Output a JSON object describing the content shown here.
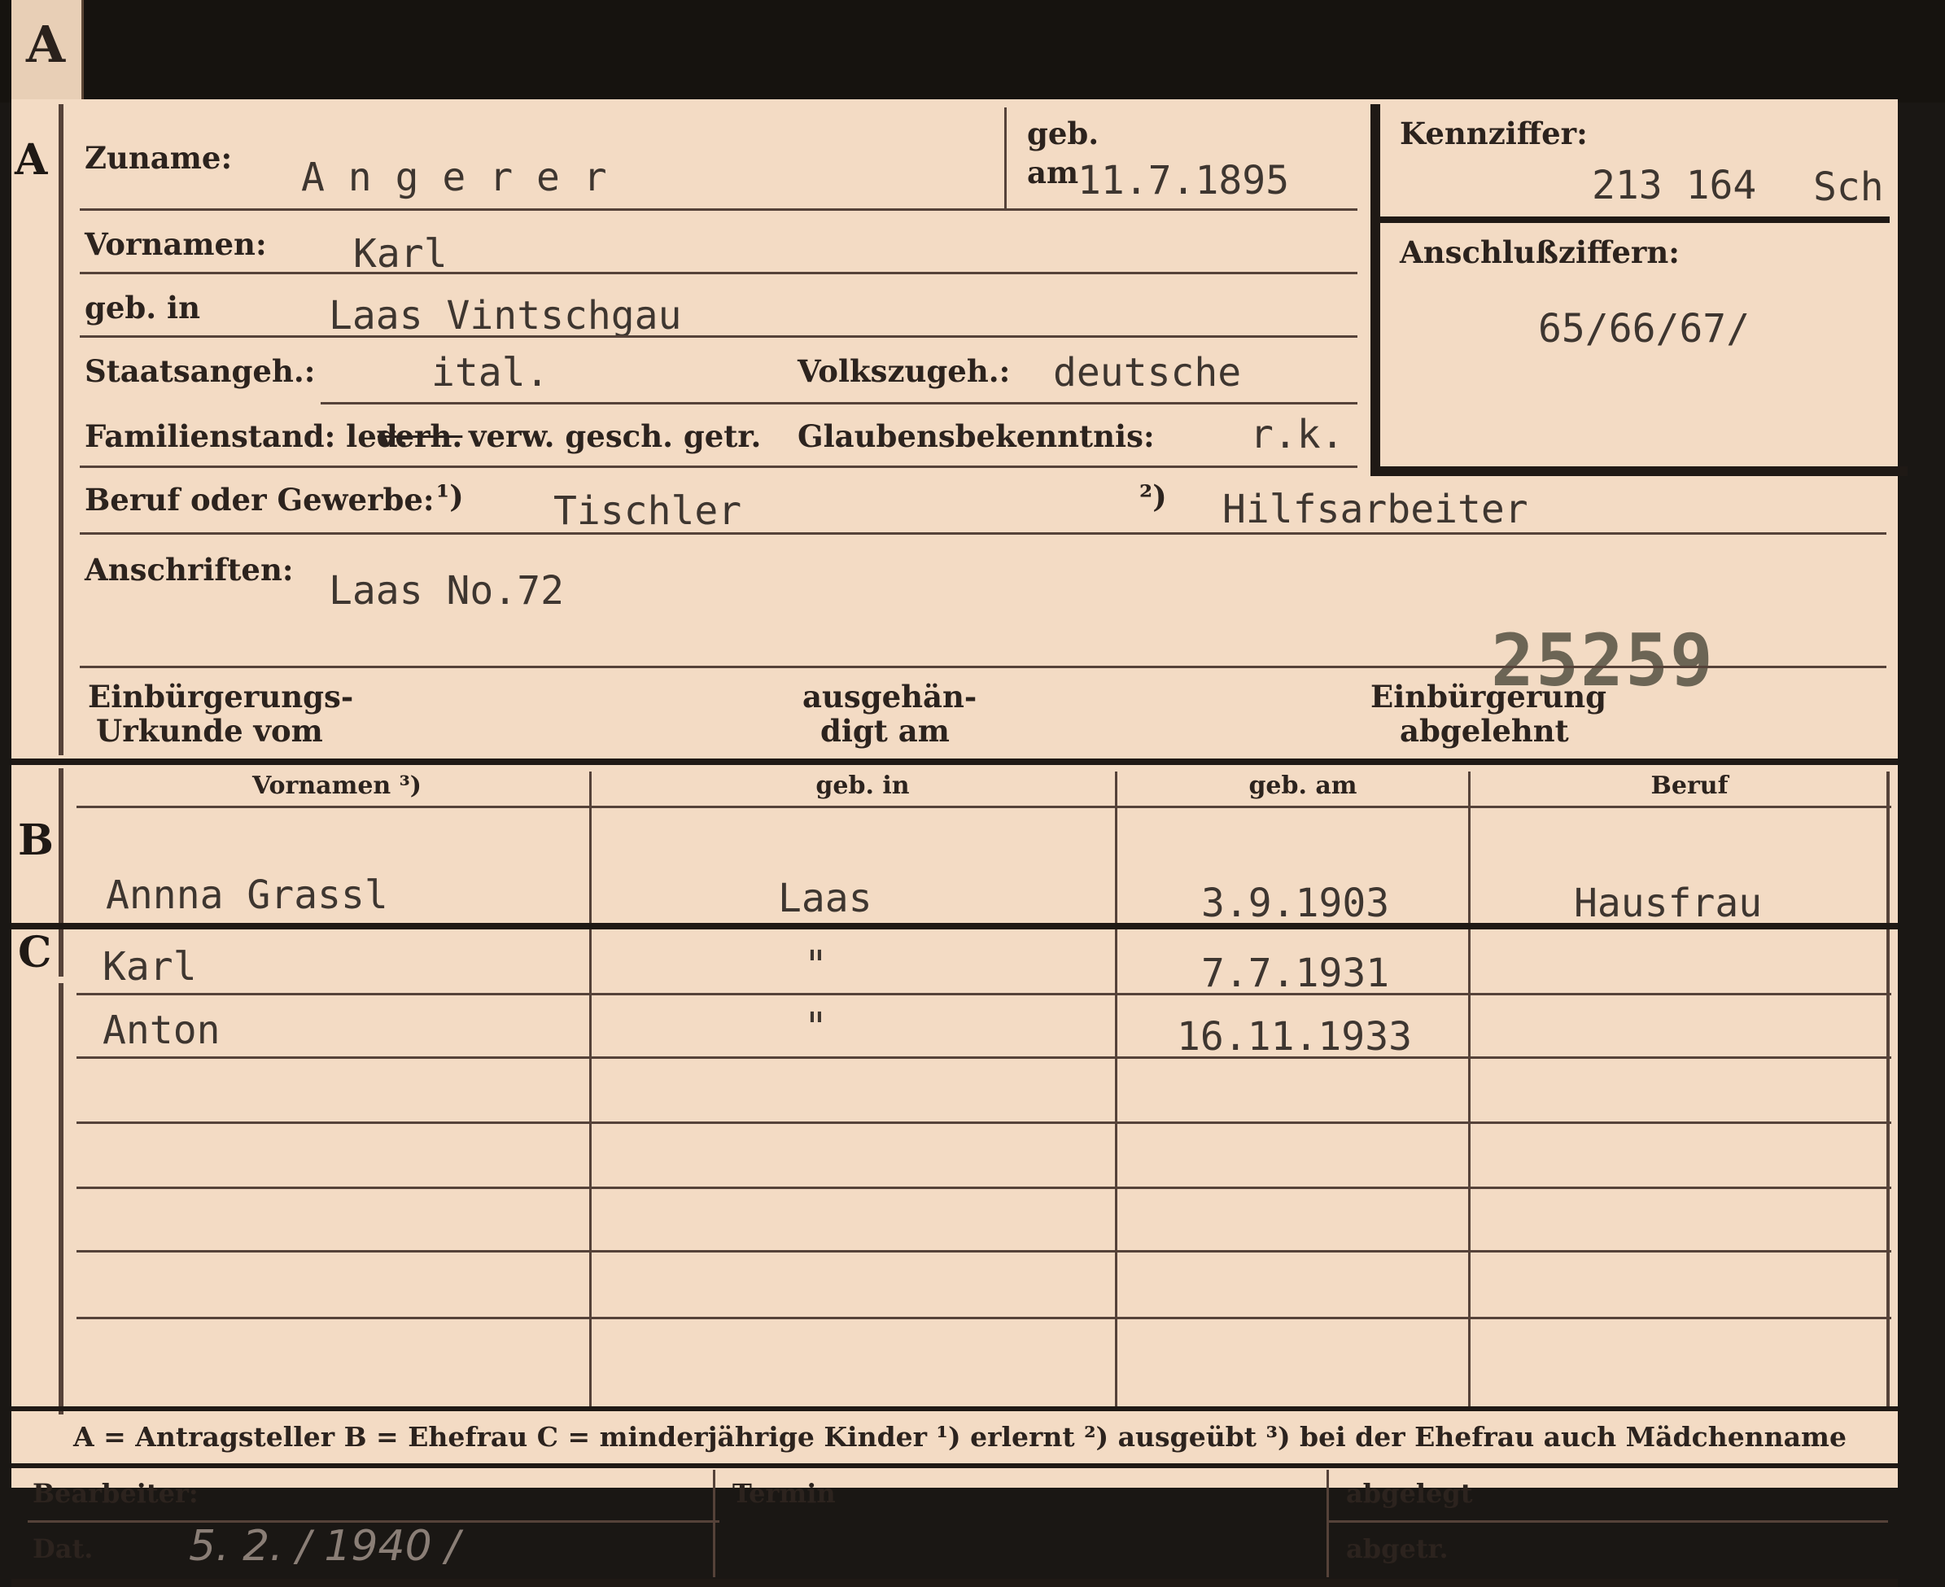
{
  "tab_letter": "A",
  "sections": {
    "a": "A",
    "b": "B",
    "c": "C"
  },
  "labels": {
    "zuname": "Zuname:",
    "geb": "geb.",
    "am": "am",
    "vornamen": "Vornamen:",
    "geb_in": "geb. in",
    "staatsangeh": "Staatsangeh.:",
    "volkszugeh": "Volkszugeh.:",
    "familienstand_prefix": "Familienstand: led.",
    "familienstand_struck": "verh.",
    "familienstand_rest": "verw. gesch. getr.",
    "glaubensbekenntnis": "Glaubensbekenntnis:",
    "beruf": "Beruf oder Gewerbe:",
    "note1": "¹)",
    "note2": "²)",
    "anschriften": "Anschriften:",
    "einb_urkunde_1": "Einbürgerungs-",
    "einb_urkunde_2": "Urkunde vom",
    "ausgehaendigt_1": "ausgehän-",
    "ausgehaendigt_2": "digt am",
    "einb_abgelehnt_1": "Einbürgerung",
    "einb_abgelehnt_2": "abgelehnt",
    "kennziffer": "Kennziffer:",
    "anschlussziffern": "Anschlußziffern:"
  },
  "applicant": {
    "surname": "A n g e r e r",
    "birth_date": "11.7.1895",
    "first_names": "Karl",
    "birth_place": "Laas Vintschgau",
    "citizenship": "ital.",
    "ethnicity": "deutsche",
    "religion": "r.k.",
    "occupation_learned": "Tischler",
    "occupation_practiced": "Hilfsarbeiter",
    "address": "Laas No.72",
    "kennziffer": "213 164",
    "kennziffer_suffix": "Sch",
    "anschlussziffern": "65/66/67/"
  },
  "stamp_number": "25259",
  "table": {
    "headers": [
      "Vornamen ³)",
      "geb. in",
      "geb. am",
      "Beruf"
    ],
    "wife": {
      "name": "Annna Grassl",
      "place": "Laas",
      "date": "3.9.1903",
      "job": "Hausfrau"
    },
    "children": [
      {
        "name": "Karl",
        "place": "\"",
        "date": "7.7.1931",
        "job": ""
      },
      {
        "name": "Anton",
        "place": "\"",
        "date": "16.11.1933",
        "job": ""
      }
    ]
  },
  "legend": "A = Antragsteller   B = Ehefrau   C = minderjährige Kinder   ¹) erlernt   ²) ausgeübt   ³) bei der Ehefrau auch Mädchenname",
  "footer": {
    "bearbeiter": "Bearbeiter:",
    "dat": "Dat.",
    "dat_value": "5. 2. / 1940 /",
    "termin": "Termin",
    "abgelegt": "abgelegt",
    "abgetr": "abgetr."
  },
  "colors": {
    "card": "#f3dbc4",
    "ink": "#2c231e",
    "typewriter": "#3e3630",
    "frame": "#16130f"
  }
}
